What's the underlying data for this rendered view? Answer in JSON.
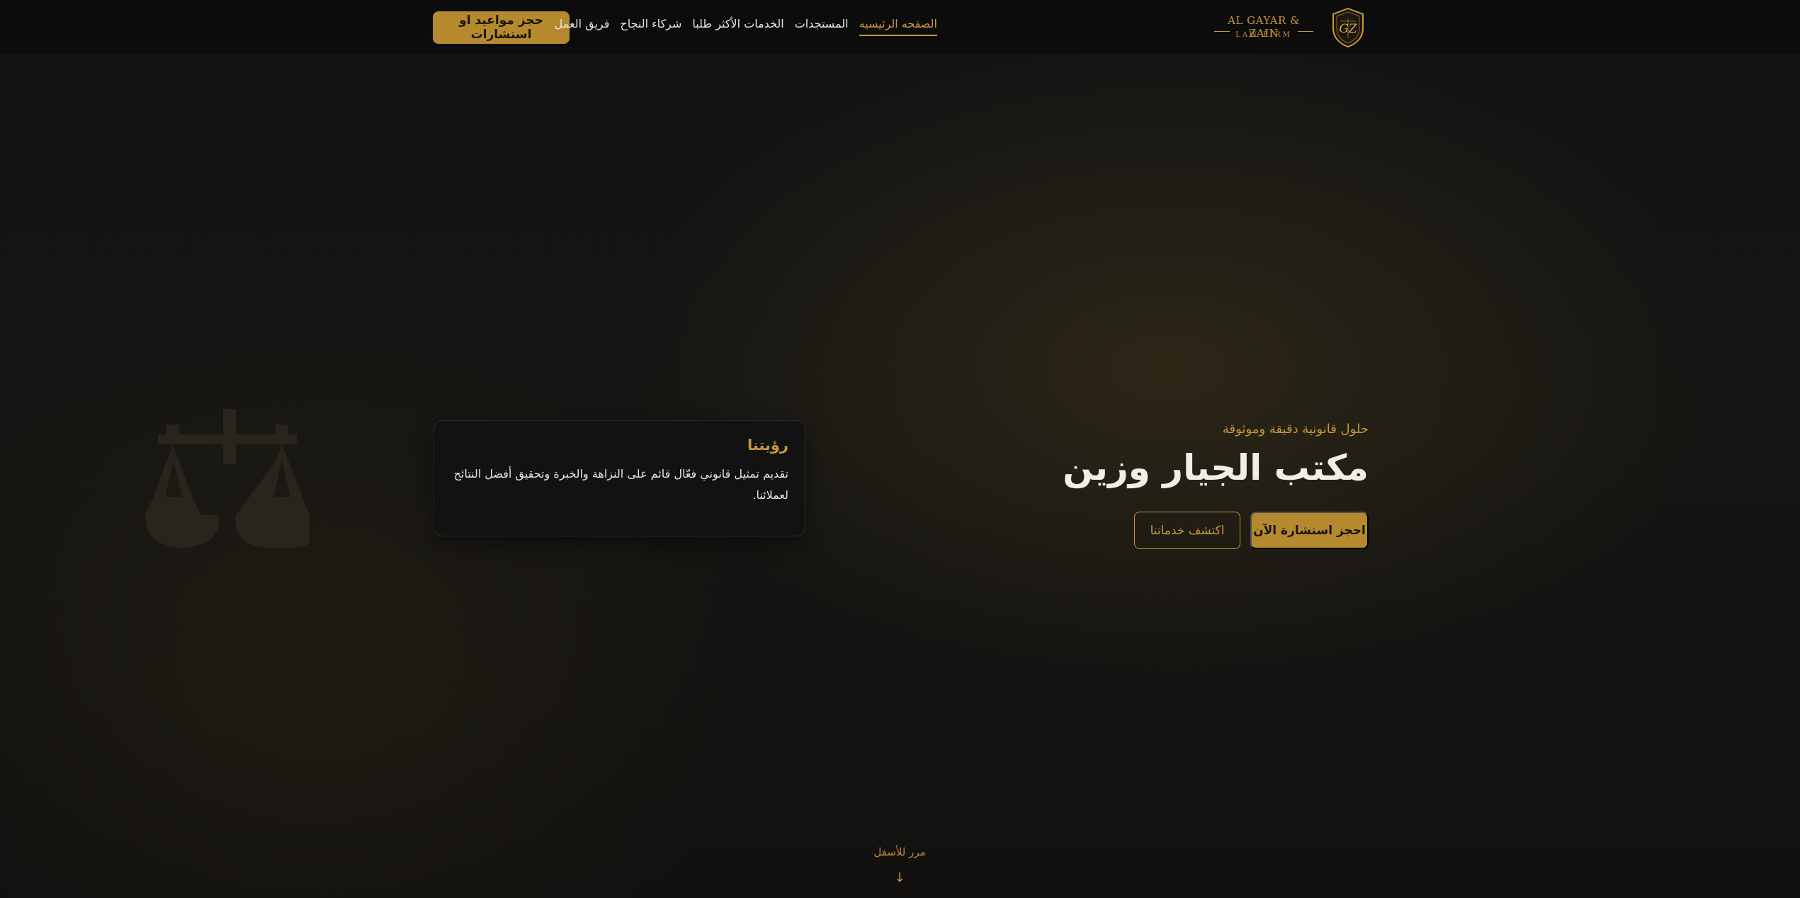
{
  "header": {
    "cta_label": "حجز مواعيد او استشارات",
    "nav": [
      {
        "label": "الصفحه الرئيسيه",
        "active": true
      },
      {
        "label": "المستجدات",
        "active": false
      },
      {
        "label": "الخدمات الأكثر طلبا",
        "active": false
      },
      {
        "label": "شركاء النجاح",
        "active": false
      },
      {
        "label": "فريق العمل",
        "active": false
      }
    ],
    "logo": {
      "line1": "AL GAYAR & ZAIN",
      "line2": "LAW FIRM",
      "monogram": "GZ"
    }
  },
  "hero": {
    "kicker": "حلول قانونية دقيقة وموثوقة",
    "title": "مكتب الجيار وزين",
    "primary_button": "احجز استشارة الآن",
    "secondary_button": "اكتشف خدماتنا"
  },
  "vision": {
    "title": "رؤيتنا",
    "body": "تقديم تمثيل قانوني فعّال قائم على النزاهة والخبرة وتحقيق أفضل النتائج لعملائنا."
  },
  "decor": {
    "scales_icon": "scales-of-justice-icon"
  },
  "scroll": {
    "label": "مرر للأسفل",
    "arrow": "↓"
  },
  "colors": {
    "accent": "#c8973c",
    "button_fill": "#b58a2f",
    "header_bg": "#0c0c0c",
    "page_bg": "#141414"
  }
}
